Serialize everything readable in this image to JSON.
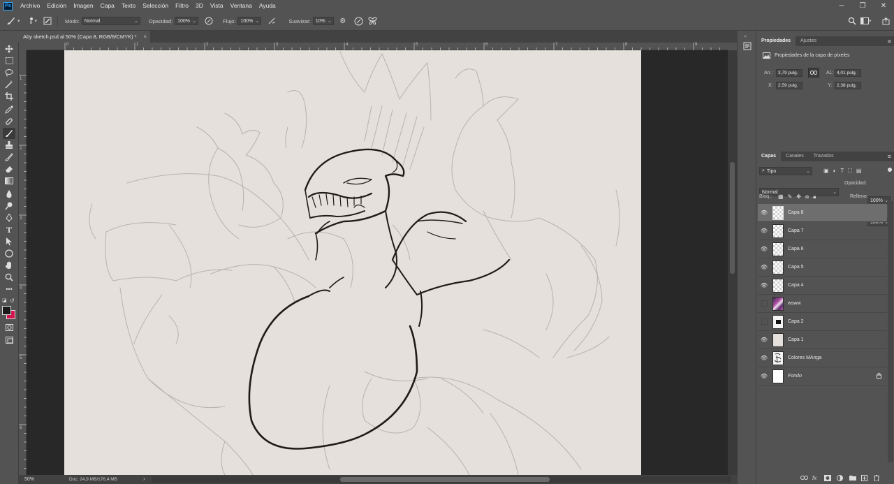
{
  "menu": {
    "logo": "Ps",
    "items": [
      "Archivo",
      "Edición",
      "Imagen",
      "Capa",
      "Texto",
      "Selección",
      "Filtro",
      "3D",
      "Vista",
      "Ventana",
      "Ayuda"
    ],
    "window_controls": [
      "─",
      "❐",
      "✕"
    ]
  },
  "options": {
    "brush_size": "8",
    "mode_label": "Modo:",
    "mode_value": "Normal",
    "opacity_label": "Opacidad:",
    "opacity_value": "100%",
    "flow_label": "Flujo:",
    "flow_value": "100%",
    "smooth_label": "Suavizar:",
    "smooth_value": "10%"
  },
  "document": {
    "tab_title": "Aby sketch.psd al 50% (Capa 8, RGB/8/CMYK) *",
    "close": "×"
  },
  "rulers": {
    "h": [
      "0",
      "1",
      "2",
      "3",
      "4",
      "5",
      "6",
      "7",
      "8",
      "9"
    ],
    "v": [
      "1",
      "2",
      "3",
      "4",
      "5",
      "6"
    ]
  },
  "status": {
    "zoom": "50%",
    "doc_info": "Doc: 24,9 MB/176,4 MB"
  },
  "properties": {
    "tabs": [
      "Propiedades",
      "Ajustes"
    ],
    "heading": "Propiedades de la capa de píxeles",
    "width_label": "An.:",
    "width_value": "3,79 pulg.",
    "height_label": "AL:",
    "height_value": "4,01 pulg.",
    "x_label": "X:",
    "x_value": "2,59 pulg.",
    "y_label": "Y:",
    "y_value": "2,38 pulg."
  },
  "layers_panel": {
    "tabs": [
      "Capas",
      "Canales",
      "Trazados"
    ],
    "filter_value": "Tipo",
    "blend_value": "Normal",
    "opacity_label": "Opacidad:",
    "opacity_value": "100%",
    "lock_label": "Bloq.:",
    "fill_label": "Relleno:",
    "fill_value": "100%",
    "layers": [
      {
        "name": "Capa 8",
        "visible": true,
        "selected": true,
        "thumb": "checker"
      },
      {
        "name": "Capa 7",
        "visible": true,
        "selected": false,
        "thumb": "checker"
      },
      {
        "name": "Capa 6",
        "visible": true,
        "selected": false,
        "thumb": "checker"
      },
      {
        "name": "Capa 5",
        "visible": true,
        "selected": false,
        "thumb": "checker"
      },
      {
        "name": "Capa 4",
        "visible": true,
        "selected": false,
        "thumb": "checker"
      },
      {
        "name": "wsww",
        "visible": false,
        "selected": false,
        "thumb": "image"
      },
      {
        "name": "Capa 2",
        "visible": false,
        "selected": false,
        "thumb": "dark"
      },
      {
        "name": "Capa 1",
        "visible": true,
        "selected": false,
        "thumb": "plain"
      },
      {
        "name": "Colores MAnga",
        "visible": true,
        "selected": false,
        "thumb": "manga"
      },
      {
        "name": "Fondo",
        "visible": true,
        "selected": false,
        "thumb": "white",
        "locked": true
      }
    ],
    "bottom_icons": [
      "link-icon",
      "fx-icon",
      "mask-icon",
      "adjustment-icon",
      "folder-icon",
      "new-layer-icon",
      "trash-icon"
    ]
  },
  "colors": {
    "foreground": "#1a1a1a",
    "background": "#d3154f",
    "canvas": "#e5e0dc"
  }
}
